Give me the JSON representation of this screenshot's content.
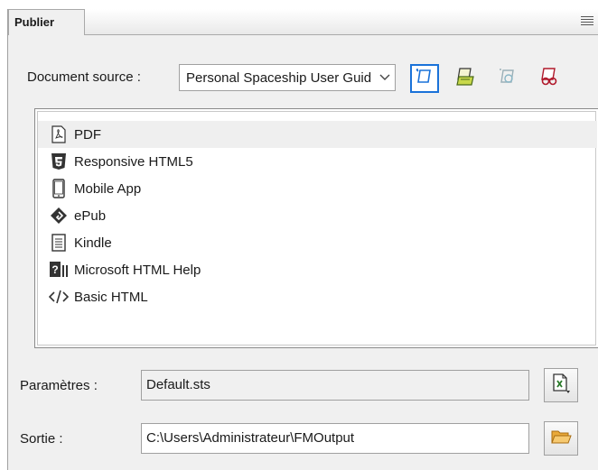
{
  "panel": {
    "tab_label": "Publier",
    "menu_icon": "hamburger-menu-icon"
  },
  "source": {
    "label": "Document source :",
    "selected": "Personal Spaceship User Guide"
  },
  "toolbar": [
    {
      "icon": "edit-output-icon",
      "active": true
    },
    {
      "icon": "publish-output-icon",
      "active": false
    },
    {
      "icon": "disabled-output-icon",
      "active": false
    },
    {
      "icon": "remove-output-icon",
      "active": false
    }
  ],
  "formats": [
    {
      "label": "PDF",
      "icon": "pdf-icon",
      "selected": true
    },
    {
      "label": "Responsive HTML5",
      "icon": "html5-icon",
      "selected": false
    },
    {
      "label": "Mobile App",
      "icon": "mobile-icon",
      "selected": false
    },
    {
      "label": "ePub",
      "icon": "epub-icon",
      "selected": false
    },
    {
      "label": "Kindle",
      "icon": "kindle-icon",
      "selected": false
    },
    {
      "label": "Microsoft HTML Help",
      "icon": "html-help-icon",
      "selected": false
    },
    {
      "label": "Basic HTML",
      "icon": "code-icon",
      "selected": false
    }
  ],
  "settings": {
    "label": "Paramètres :",
    "value": "Default.sts",
    "button_icon": "settings-file-icon"
  },
  "output": {
    "label": "Sortie :",
    "value": "C:\\Users\\Administrateur\\FMOutput",
    "button_icon": "folder-icon"
  },
  "colors": {
    "accent": "#1a72d9",
    "panel_bg": "#f0f0f0",
    "list_bg": "#ffffff"
  }
}
